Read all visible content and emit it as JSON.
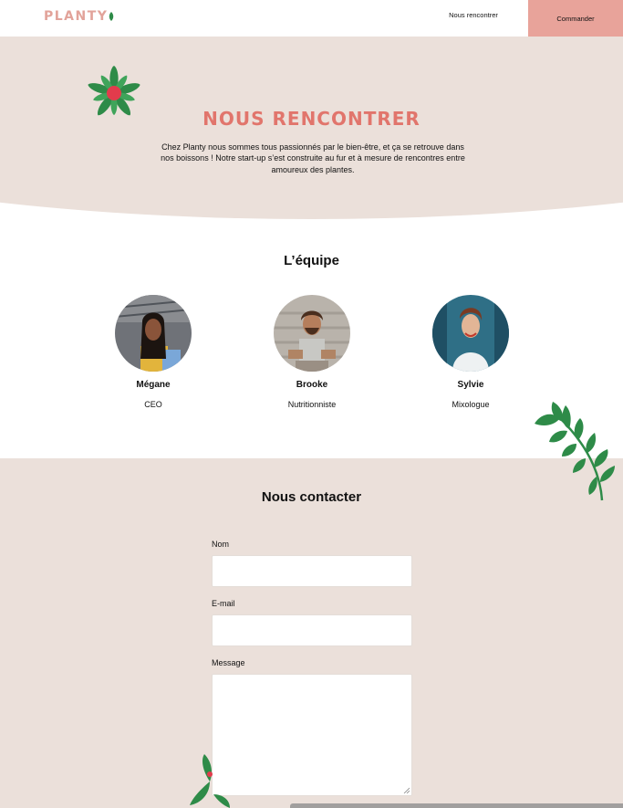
{
  "header": {
    "logo": "PLANTY",
    "nav_link": "Nous rencontrer",
    "cta": "Commander"
  },
  "hero": {
    "title": "NOUS RENCONTRER",
    "text": "Chez Planty nous sommes tous passionnés par le bien-être, et ça se retrouve dans nos boissons ! Notre start-up s’est construite au fur et à mesure de rencontres entre amoureux des plantes."
  },
  "team": {
    "title": "L’équipe",
    "members": [
      {
        "name": "Mégane",
        "role": "CEO"
      },
      {
        "name": "Brooke",
        "role": "Nutritionniste"
      },
      {
        "name": "Sylvie",
        "role": "Mixologue"
      }
    ]
  },
  "contact": {
    "title": "Nous contacter",
    "name_label": "Nom",
    "email_label": "E-mail",
    "message_label": "Message",
    "name_value": "",
    "email_value": "",
    "message_value": ""
  },
  "colors": {
    "accent": "#e1756c",
    "cta_bg": "#e8a39a",
    "section_bg": "#ebe0da",
    "leaf_green": "#2e8b48"
  },
  "icons": [
    "leaf-icon",
    "flower-icon",
    "branch-icon"
  ]
}
